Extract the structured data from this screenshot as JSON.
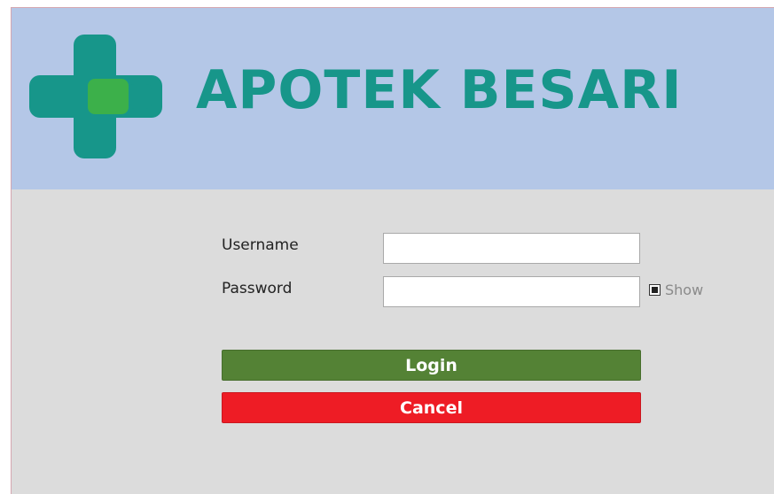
{
  "app": {
    "title": "APOTEK BESARI"
  },
  "login_form": {
    "username_label": "Username",
    "username_value": "",
    "password_label": "Password",
    "password_value": "",
    "show_label": "Show",
    "show_checked": true,
    "login_label": "Login",
    "cancel_label": "Cancel"
  },
  "icons": {
    "logo": "medical-cross-logo-icon"
  },
  "colors": {
    "header_bg": "#b4c7e7",
    "body_bg": "#dcdcdc",
    "brand_teal": "#17968a",
    "logo_green": "#3cb04a",
    "login_button": "#548235",
    "cancel_button": "#ee1c25"
  }
}
